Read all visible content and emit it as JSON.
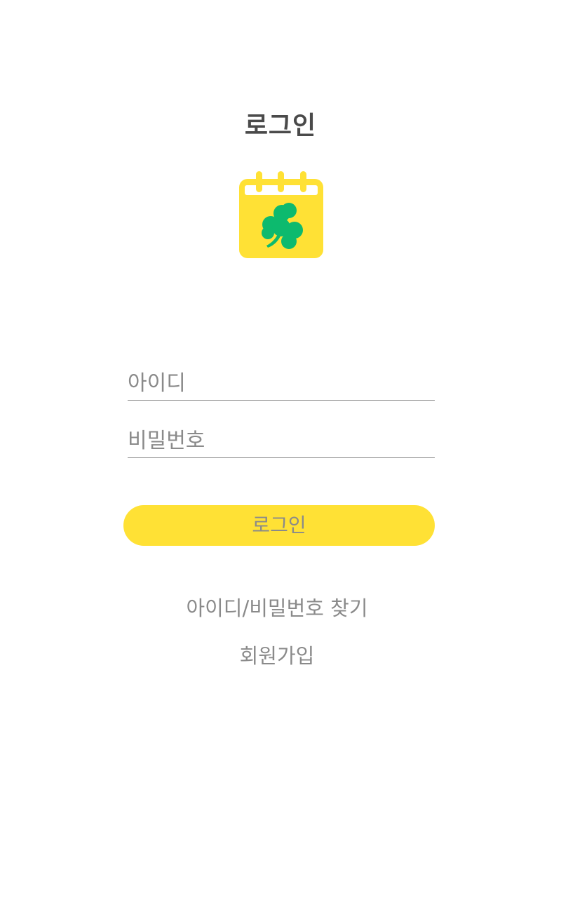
{
  "header": {
    "title": "로그인"
  },
  "logo": {
    "icon": "calendar-clover-icon",
    "calendar_color": "#FFE135",
    "clover_color": "#0DBA6E"
  },
  "form": {
    "id_placeholder": "아이디",
    "id_value": "",
    "password_placeholder": "비밀번호",
    "password_value": "",
    "login_label": "로그인"
  },
  "links": {
    "find_account": "아이디/비밀번호 찾기",
    "signup": "회원가입"
  },
  "colors": {
    "accent": "#FFE135",
    "text_muted": "#8A8A8A",
    "title": "#4A4A4A"
  }
}
